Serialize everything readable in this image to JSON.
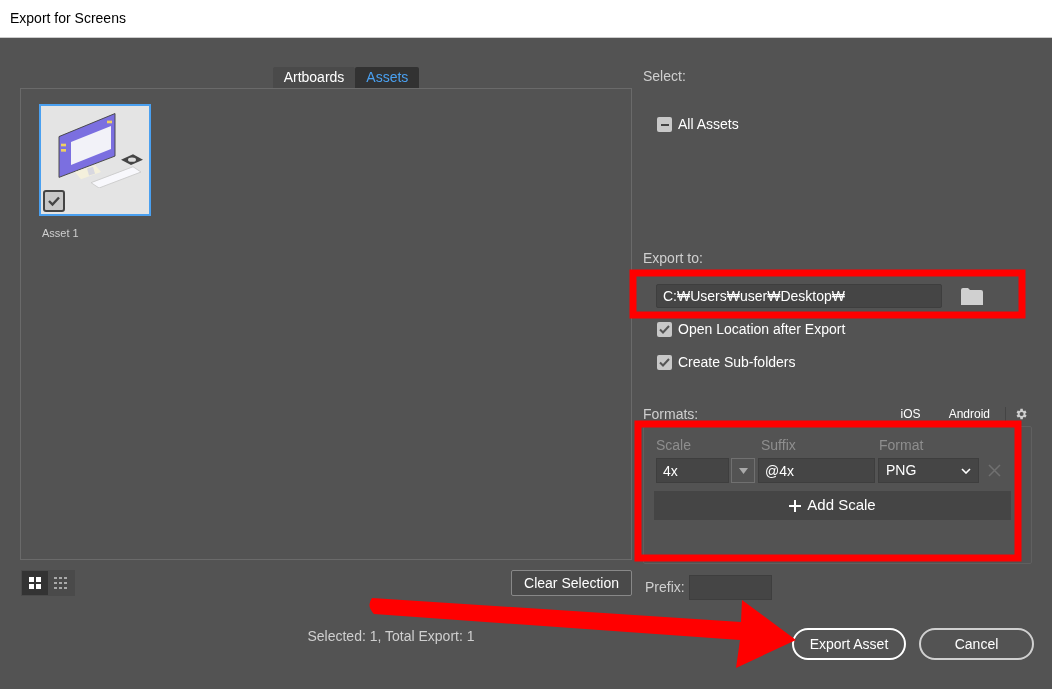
{
  "window": {
    "title": "Export for Screens"
  },
  "tabs": [
    {
      "label": "Artboards",
      "selected": false
    },
    {
      "label": "Assets",
      "selected": true
    }
  ],
  "assets": [
    {
      "name": "Asset 1",
      "checked": true,
      "selected": true
    }
  ],
  "view_toggles": [
    {
      "kind": "grid",
      "selected": true
    },
    {
      "kind": "list",
      "selected": false
    }
  ],
  "clear_selection_button": "Clear Selection",
  "select": {
    "label": "Select:",
    "all_assets": {
      "label": "All Assets",
      "indeterminate": true
    }
  },
  "export_to": {
    "label": "Export to:",
    "path": "C:₩Users₩user₩Desktop₩"
  },
  "options": [
    {
      "label": "Open Location after Export",
      "checked": true
    },
    {
      "label": "Create Sub-folders",
      "checked": true
    }
  ],
  "formats": {
    "label": "Formats:",
    "platforms": [
      "iOS",
      "Android"
    ],
    "columns": [
      "Scale",
      "Suffix",
      "Format"
    ],
    "rows": [
      {
        "scale": "4x",
        "suffix": "@4x",
        "format": "PNG"
      }
    ],
    "add_button": "Add Scale"
  },
  "prefix": {
    "label": "Prefix:"
  },
  "status": "Selected: 1, Total Export: 1",
  "buttons": [
    {
      "label": "Export Asset",
      "kind": "primary"
    },
    {
      "label": "Cancel",
      "kind": "secondary"
    }
  ],
  "annotations": [
    {
      "kind": "box",
      "color": "#ff0000"
    },
    {
      "kind": "box",
      "color": "#ff0000"
    },
    {
      "kind": "arrow",
      "color": "#ff0000"
    }
  ]
}
